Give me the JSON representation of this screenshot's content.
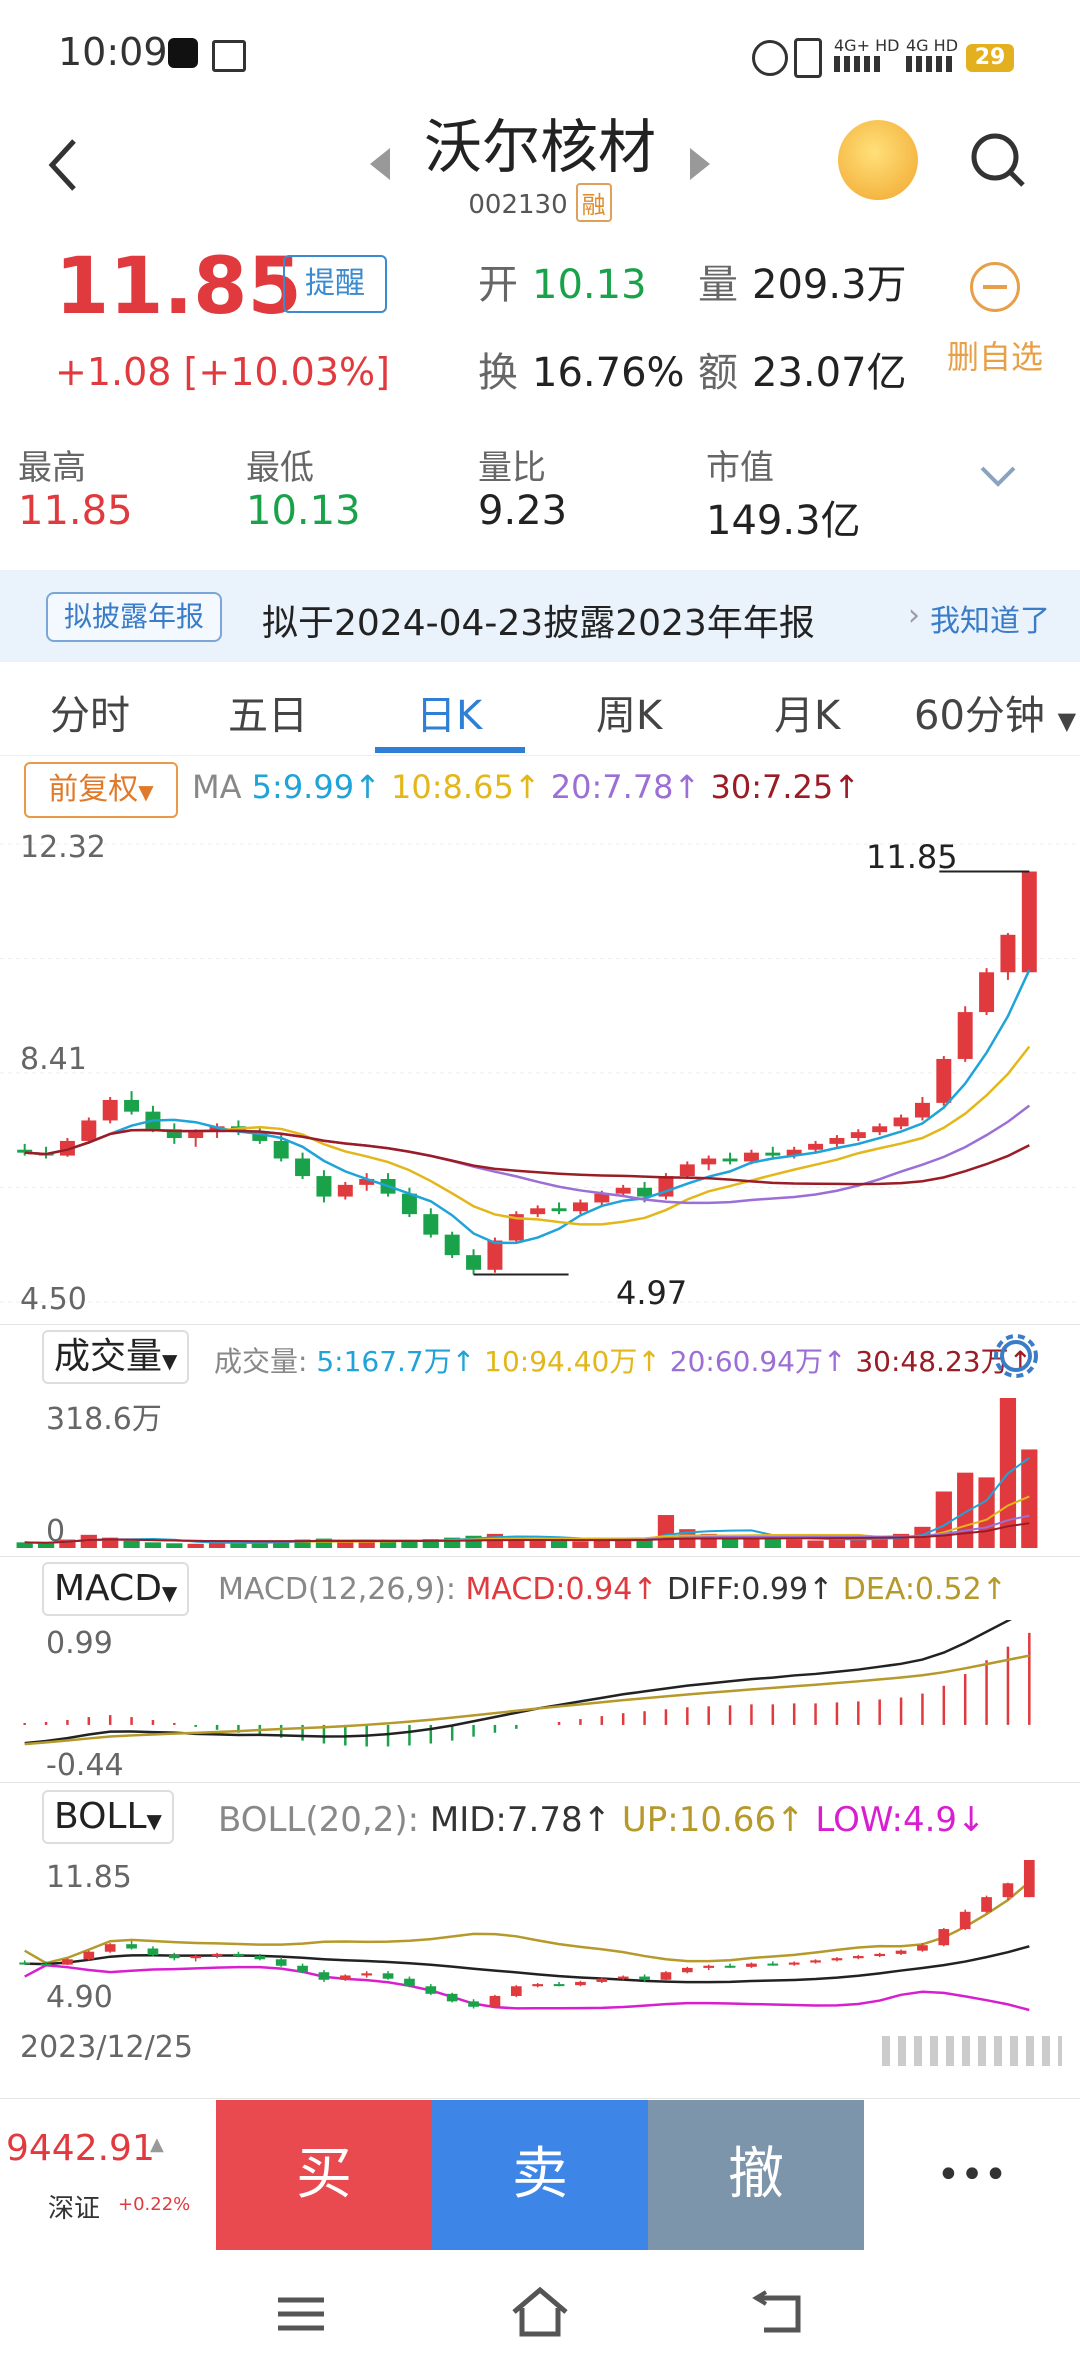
{
  "status": {
    "time": "10:09",
    "battery": "29",
    "net1": "4G+ HD",
    "net2": "4G HD"
  },
  "header": {
    "title": "沃尔核材",
    "code": "002130",
    "margin_badge": "融"
  },
  "quote": {
    "price": "11.85",
    "change": "+1.08",
    "change_pct": "[+10.03%]",
    "remind_label": "提醒",
    "open_label": "开",
    "open": "10.13",
    "volume_label": "量",
    "volume": "209.3万",
    "turnover_label": "换",
    "turnover": "16.76%",
    "amount_label": "额",
    "amount": "23.07亿",
    "remove_label": "删自选",
    "high_label": "最高",
    "high": "11.85",
    "low_label": "最低",
    "low": "10.13",
    "vol_ratio_label": "量比",
    "vol_ratio": "9.23",
    "mcap_label": "市值",
    "mcap": "149.3亿"
  },
  "banner": {
    "tag": "拟披露年报",
    "text": "拟于2024-04-23披露2023年年报",
    "ack": "我知道了"
  },
  "tabs": [
    "分时",
    "五日",
    "日K",
    "周K",
    "月K",
    "60分钟"
  ],
  "active_tab": 2,
  "kline": {
    "adjust": "前复权",
    "ma_label": "MA",
    "ma5": "5:9.99",
    "ma10": "10:8.65",
    "ma20": "20:7.78",
    "ma30": "30:7.25",
    "y_top": "12.32",
    "y_mid": "8.41",
    "y_bottom": "4.50",
    "max_label": "11.85",
    "min_label": "4.97"
  },
  "volume": {
    "label": "成交量",
    "prefix": "成交量:",
    "v5": "5:167.7万",
    "v10": "10:94.40万",
    "v20": "20:60.94万",
    "v30": "30:48.23万",
    "y_top": "318.6万",
    "y_bottom": "0"
  },
  "macd": {
    "label": "MACD",
    "params": "MACD(12,26,9):",
    "macd": "MACD:0.94",
    "diff": "DIFF:0.99",
    "dea": "DEA:0.52",
    "y_top": "0.99",
    "y_bottom": "-0.44"
  },
  "boll": {
    "label": "BOLL",
    "params": "BOLL(20,2):",
    "mid": "MID:7.78",
    "up": "UP:10.66",
    "low": "LOW:4.9",
    "y_top": "11.85",
    "y_bottom": "4.90"
  },
  "start_date": "2023/12/25",
  "index": {
    "value": "9442.91",
    "name": "深证",
    "pct": "+0.22%"
  },
  "actions": {
    "buy": "买",
    "sell": "卖",
    "cancel": "撤",
    "more": "•••"
  },
  "colors": {
    "up": "#e03a3e",
    "down": "#1aa24a",
    "ma5": "#1fa3d8",
    "ma10": "#e3b71a",
    "ma20": "#9b6fd6",
    "ma30": "#9a1c25",
    "buy": "#e84a4f",
    "sell": "#3d86e8",
    "cancel": "#7d95ab"
  },
  "chart_data": [
    {
      "type": "candlestick",
      "title": "日K",
      "ylim": [
        4.5,
        12.32
      ],
      "y_ticks": [
        "12.32",
        "8.41",
        "4.50"
      ],
      "annotations": [
        {
          "label": "11.85",
          "kind": "max"
        },
        {
          "label": "4.97",
          "kind": "min"
        }
      ],
      "series": [
        {
          "name": "K",
          "candles": [
            [
              7.1,
              7.2,
              7.0,
              7.05
            ],
            [
              7.05,
              7.15,
              6.95,
              7.0
            ],
            [
              7.0,
              7.3,
              6.98,
              7.25
            ],
            [
              7.25,
              7.65,
              7.2,
              7.6
            ],
            [
              7.6,
              8.0,
              7.55,
              7.95
            ],
            [
              7.95,
              8.1,
              7.7,
              7.75
            ],
            [
              7.75,
              7.85,
              7.4,
              7.45
            ],
            [
              7.45,
              7.55,
              7.2,
              7.3
            ],
            [
              7.3,
              7.45,
              7.15,
              7.4
            ],
            [
              7.4,
              7.55,
              7.3,
              7.5
            ],
            [
              7.5,
              7.6,
              7.35,
              7.4
            ],
            [
              7.4,
              7.5,
              7.2,
              7.25
            ],
            [
              7.25,
              7.35,
              6.9,
              6.95
            ],
            [
              6.95,
              7.05,
              6.6,
              6.65
            ],
            [
              6.65,
              6.75,
              6.2,
              6.3
            ],
            [
              6.3,
              6.55,
              6.25,
              6.5
            ],
            [
              6.5,
              6.7,
              6.4,
              6.6
            ],
            [
              6.6,
              6.7,
              6.3,
              6.35
            ],
            [
              6.35,
              6.45,
              5.95,
              6.0
            ],
            [
              6.0,
              6.1,
              5.6,
              5.65
            ],
            [
              5.65,
              5.7,
              5.25,
              5.3
            ],
            [
              5.3,
              5.4,
              4.97,
              5.05
            ],
            [
              5.05,
              5.6,
              5.0,
              5.55
            ],
            [
              5.55,
              6.05,
              5.5,
              6.0
            ],
            [
              6.0,
              6.15,
              5.95,
              6.1
            ],
            [
              6.1,
              6.2,
              6.0,
              6.05
            ],
            [
              6.05,
              6.25,
              6.0,
              6.2
            ],
            [
              6.2,
              6.4,
              6.15,
              6.35
            ],
            [
              6.35,
              6.5,
              6.3,
              6.45
            ],
            [
              6.45,
              6.55,
              6.2,
              6.3
            ],
            [
              6.3,
              6.7,
              6.25,
              6.65
            ],
            [
              6.65,
              6.9,
              6.6,
              6.85
            ],
            [
              6.85,
              7.0,
              6.75,
              6.95
            ],
            [
              6.95,
              7.05,
              6.85,
              6.9
            ],
            [
              6.9,
              7.1,
              6.85,
              7.05
            ],
            [
              7.05,
              7.15,
              6.95,
              7.0
            ],
            [
              7.0,
              7.15,
              6.95,
              7.1
            ],
            [
              7.1,
              7.25,
              7.05,
              7.2
            ],
            [
              7.2,
              7.35,
              7.15,
              7.3
            ],
            [
              7.3,
              7.45,
              7.25,
              7.4
            ],
            [
              7.4,
              7.55,
              7.35,
              7.5
            ],
            [
              7.5,
              7.7,
              7.45,
              7.65
            ],
            [
              7.65,
              8.0,
              7.6,
              7.9
            ],
            [
              7.9,
              8.7,
              7.85,
              8.65
            ],
            [
              8.65,
              9.55,
              8.6,
              9.45
            ],
            [
              9.45,
              10.2,
              9.4,
              10.13
            ],
            [
              10.13,
              10.8,
              10.0,
              10.77
            ],
            [
              10.13,
              11.85,
              10.13,
              11.85
            ]
          ]
        },
        {
          "name": "MA5",
          "last": 9.99
        },
        {
          "name": "MA10",
          "last": 8.65
        },
        {
          "name": "MA20",
          "last": 7.78
        },
        {
          "name": "MA30",
          "last": 7.25
        }
      ]
    },
    {
      "type": "bar",
      "title": "成交量",
      "ylim": [
        0,
        318.6
      ],
      "y_ticks": [
        "318.6万",
        "0"
      ],
      "series": [
        {
          "name": "成交量",
          "values": [
            12,
            10,
            18,
            28,
            22,
            15,
            12,
            10,
            9,
            11,
            13,
            12,
            16,
            18,
            20,
            14,
            13,
            15,
            17,
            19,
            22,
            26,
            30,
            25,
            18,
            15,
            14,
            16,
            18,
            20,
            70,
            40,
            30,
            25,
            22,
            20,
            18,
            16,
            18,
            20,
            24,
            30,
            45,
            120,
            160,
            150,
            318.6,
            209.3
          ]
        }
      ]
    },
    {
      "type": "bar",
      "title": "MACD",
      "ylim": [
        -0.44,
        0.99
      ],
      "y_ticks": [
        "0.99",
        "-0.44"
      ],
      "series": [
        {
          "name": "MACD",
          "values": [
            0.02,
            0.03,
            0.05,
            0.08,
            0.1,
            0.08,
            0.05,
            0.02,
            -0.02,
            -0.05,
            -0.08,
            -0.1,
            -0.13,
            -0.16,
            -0.19,
            -0.21,
            -0.22,
            -0.22,
            -0.21,
            -0.19,
            -0.16,
            -0.12,
            -0.08,
            -0.04,
            0.0,
            0.03,
            0.06,
            0.09,
            0.12,
            0.14,
            0.16,
            0.18,
            0.19,
            0.2,
            0.21,
            0.21,
            0.22,
            0.22,
            0.23,
            0.24,
            0.26,
            0.28,
            0.32,
            0.4,
            0.52,
            0.66,
            0.8,
            0.94
          ]
        }
      ]
    },
    {
      "type": "line",
      "title": "BOLL",
      "ylim": [
        4.9,
        11.85
      ],
      "y_ticks": [
        "11.85",
        "4.90"
      ],
      "series": [
        {
          "name": "MID",
          "last": 7.78
        },
        {
          "name": "UP",
          "last": 10.66
        },
        {
          "name": "LOW",
          "last": 4.9
        }
      ]
    }
  ]
}
